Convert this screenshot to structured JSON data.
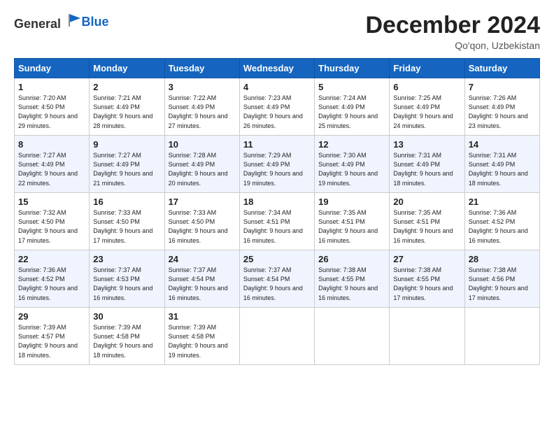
{
  "logo": {
    "general": "General",
    "blue": "Blue"
  },
  "title": "December 2024",
  "location": "Qo'qon, Uzbekistan",
  "days_of_week": [
    "Sunday",
    "Monday",
    "Tuesday",
    "Wednesday",
    "Thursday",
    "Friday",
    "Saturday"
  ],
  "weeks": [
    [
      {
        "day": 1,
        "sunrise": "7:20 AM",
        "sunset": "4:50 PM",
        "daylight": "9 hours and 29 minutes."
      },
      {
        "day": 2,
        "sunrise": "7:21 AM",
        "sunset": "4:49 PM",
        "daylight": "9 hours and 28 minutes."
      },
      {
        "day": 3,
        "sunrise": "7:22 AM",
        "sunset": "4:49 PM",
        "daylight": "9 hours and 27 minutes."
      },
      {
        "day": 4,
        "sunrise": "7:23 AM",
        "sunset": "4:49 PM",
        "daylight": "9 hours and 26 minutes."
      },
      {
        "day": 5,
        "sunrise": "7:24 AM",
        "sunset": "4:49 PM",
        "daylight": "9 hours and 25 minutes."
      },
      {
        "day": 6,
        "sunrise": "7:25 AM",
        "sunset": "4:49 PM",
        "daylight": "9 hours and 24 minutes."
      },
      {
        "day": 7,
        "sunrise": "7:26 AM",
        "sunset": "4:49 PM",
        "daylight": "9 hours and 23 minutes."
      }
    ],
    [
      {
        "day": 8,
        "sunrise": "7:27 AM",
        "sunset": "4:49 PM",
        "daylight": "9 hours and 22 minutes."
      },
      {
        "day": 9,
        "sunrise": "7:27 AM",
        "sunset": "4:49 PM",
        "daylight": "9 hours and 21 minutes."
      },
      {
        "day": 10,
        "sunrise": "7:28 AM",
        "sunset": "4:49 PM",
        "daylight": "9 hours and 20 minutes."
      },
      {
        "day": 11,
        "sunrise": "7:29 AM",
        "sunset": "4:49 PM",
        "daylight": "9 hours and 19 minutes."
      },
      {
        "day": 12,
        "sunrise": "7:30 AM",
        "sunset": "4:49 PM",
        "daylight": "9 hours and 19 minutes."
      },
      {
        "day": 13,
        "sunrise": "7:31 AM",
        "sunset": "4:49 PM",
        "daylight": "9 hours and 18 minutes."
      },
      {
        "day": 14,
        "sunrise": "7:31 AM",
        "sunset": "4:49 PM",
        "daylight": "9 hours and 18 minutes."
      }
    ],
    [
      {
        "day": 15,
        "sunrise": "7:32 AM",
        "sunset": "4:50 PM",
        "daylight": "9 hours and 17 minutes."
      },
      {
        "day": 16,
        "sunrise": "7:33 AM",
        "sunset": "4:50 PM",
        "daylight": "9 hours and 17 minutes."
      },
      {
        "day": 17,
        "sunrise": "7:33 AM",
        "sunset": "4:50 PM",
        "daylight": "9 hours and 16 minutes."
      },
      {
        "day": 18,
        "sunrise": "7:34 AM",
        "sunset": "4:51 PM",
        "daylight": "9 hours and 16 minutes."
      },
      {
        "day": 19,
        "sunrise": "7:35 AM",
        "sunset": "4:51 PM",
        "daylight": "9 hours and 16 minutes."
      },
      {
        "day": 20,
        "sunrise": "7:35 AM",
        "sunset": "4:51 PM",
        "daylight": "9 hours and 16 minutes."
      },
      {
        "day": 21,
        "sunrise": "7:36 AM",
        "sunset": "4:52 PM",
        "daylight": "9 hours and 16 minutes."
      }
    ],
    [
      {
        "day": 22,
        "sunrise": "7:36 AM",
        "sunset": "4:52 PM",
        "daylight": "9 hours and 16 minutes."
      },
      {
        "day": 23,
        "sunrise": "7:37 AM",
        "sunset": "4:53 PM",
        "daylight": "9 hours and 16 minutes."
      },
      {
        "day": 24,
        "sunrise": "7:37 AM",
        "sunset": "4:54 PM",
        "daylight": "9 hours and 16 minutes."
      },
      {
        "day": 25,
        "sunrise": "7:37 AM",
        "sunset": "4:54 PM",
        "daylight": "9 hours and 16 minutes."
      },
      {
        "day": 26,
        "sunrise": "7:38 AM",
        "sunset": "4:55 PM",
        "daylight": "9 hours and 16 minutes."
      },
      {
        "day": 27,
        "sunrise": "7:38 AM",
        "sunset": "4:55 PM",
        "daylight": "9 hours and 17 minutes."
      },
      {
        "day": 28,
        "sunrise": "7:38 AM",
        "sunset": "4:56 PM",
        "daylight": "9 hours and 17 minutes."
      }
    ],
    [
      {
        "day": 29,
        "sunrise": "7:39 AM",
        "sunset": "4:57 PM",
        "daylight": "9 hours and 18 minutes."
      },
      {
        "day": 30,
        "sunrise": "7:39 AM",
        "sunset": "4:58 PM",
        "daylight": "9 hours and 18 minutes."
      },
      {
        "day": 31,
        "sunrise": "7:39 AM",
        "sunset": "4:58 PM",
        "daylight": "9 hours and 19 minutes."
      },
      null,
      null,
      null,
      null
    ]
  ]
}
